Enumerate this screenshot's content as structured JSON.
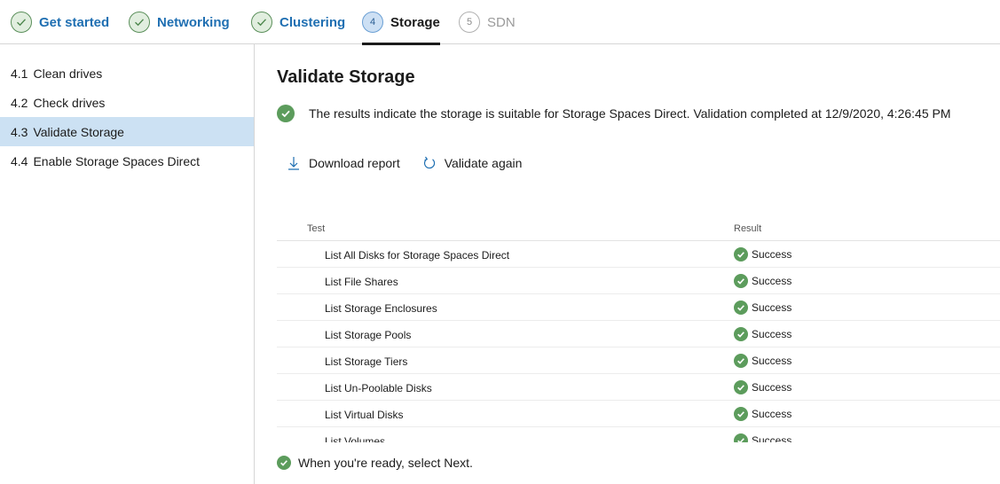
{
  "stepper": {
    "steps": [
      {
        "label": "Get started",
        "state": "done",
        "number": ""
      },
      {
        "label": "Networking",
        "state": "done",
        "number": ""
      },
      {
        "label": "Clustering",
        "state": "done",
        "number": ""
      },
      {
        "label": "Storage",
        "state": "active",
        "number": "4"
      },
      {
        "label": "SDN",
        "state": "future",
        "number": "5"
      }
    ]
  },
  "sidebar": {
    "items": [
      {
        "number": "4.1",
        "label": "Clean drives",
        "selected": false
      },
      {
        "number": "4.2",
        "label": "Check drives",
        "selected": false
      },
      {
        "number": "4.3",
        "label": "Validate Storage",
        "selected": true
      },
      {
        "number": "4.4",
        "label": "Enable Storage Spaces Direct",
        "selected": false
      }
    ]
  },
  "main": {
    "title": "Validate Storage",
    "result_message": "The results indicate the storage is suitable for Storage Spaces Direct. Validation completed at 12/9/2020, 4:26:45 PM",
    "actions": {
      "download_label": "Download report",
      "validate_label": "Validate again"
    },
    "table": {
      "headers": {
        "test": "Test",
        "result": "Result"
      },
      "rows": [
        {
          "test": "List All Disks for Storage Spaces Direct",
          "result": "Success"
        },
        {
          "test": "List File Shares",
          "result": "Success"
        },
        {
          "test": "List Storage Enclosures",
          "result": "Success"
        },
        {
          "test": "List Storage Pools",
          "result": "Success"
        },
        {
          "test": "List Storage Tiers",
          "result": "Success"
        },
        {
          "test": "List Un-Poolable Disks",
          "result": "Success"
        },
        {
          "test": "List Virtual Disks",
          "result": "Success"
        },
        {
          "test": "List Volumes",
          "result": "Success"
        }
      ]
    },
    "footer_message": "When you're ready, select Next."
  },
  "colors": {
    "accent": "#1f6fb2",
    "success": "#5c9c5c",
    "selected_bg": "#cce1f3"
  },
  "icons": {
    "step_done": "check-circle-icon",
    "success": "success-check-icon",
    "download": "download-arrow-icon",
    "validate": "refresh-icon"
  }
}
